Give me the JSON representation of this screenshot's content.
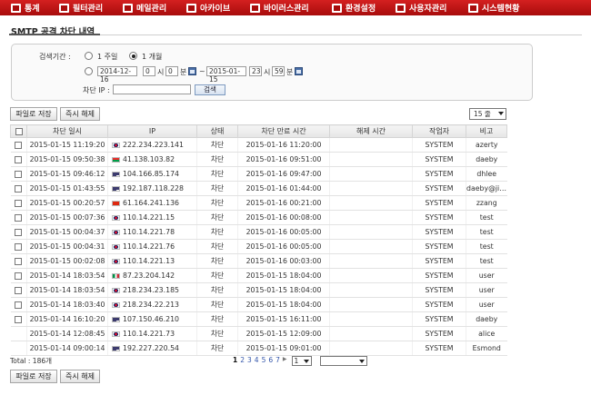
{
  "nav": [
    {
      "label": "통계",
      "icon": "chart-icon"
    },
    {
      "label": "필터관리",
      "icon": "filter-icon"
    },
    {
      "label": "메일관리",
      "icon": "mail-icon"
    },
    {
      "label": "아카이브",
      "icon": "archive-icon"
    },
    {
      "label": "바이러스관리",
      "icon": "virus-icon"
    },
    {
      "label": "환경설정",
      "icon": "settings-icon"
    },
    {
      "label": "사용자관리",
      "icon": "user-icon"
    },
    {
      "label": "시스템현황",
      "icon": "system-icon"
    }
  ],
  "page_title": "SMTP 공격 차단 내역",
  "search": {
    "period_label": "검색기간 :",
    "opt_week": "1 주일",
    "opt_month": "1 개월",
    "selected": "1 개월",
    "start_date": "2014-12-16",
    "start_hour": "0",
    "hour_unit": "시",
    "start_min": "0",
    "min_unit": "분",
    "tilde": "~",
    "end_date": "2015-01-15",
    "end_hour": "23",
    "end_min": "59",
    "ip_label": "차단 IP :",
    "ip_value": "",
    "search_button": "검색"
  },
  "toolbar": {
    "save_file": "파일로 저장",
    "unblock_now": "즉시 해제",
    "per_page": "15 줄"
  },
  "table": {
    "headers": [
      "차단 일시",
      "IP",
      "상태",
      "차단 만료 시간",
      "해제 시간",
      "작업자",
      "비고"
    ],
    "rows": [
      {
        "checkbox": true,
        "date": "2015-01-15 11:19:20",
        "flag": "kr",
        "ip": "222.234.223.141",
        "status": "차단",
        "expire": "2015-01-16 11:20:00",
        "release": "",
        "worker": "SYSTEM",
        "note": "azerty"
      },
      {
        "checkbox": true,
        "date": "2015-01-15 09:50:38",
        "flag": "bf",
        "ip": "41.138.103.82",
        "status": "차단",
        "expire": "2015-01-16 09:51:00",
        "release": "",
        "worker": "SYSTEM",
        "note": "daeby"
      },
      {
        "checkbox": true,
        "date": "2015-01-15 09:46:12",
        "flag": "us",
        "ip": "104.166.85.174",
        "status": "차단",
        "expire": "2015-01-16 09:47:00",
        "release": "",
        "worker": "SYSTEM",
        "note": "dhlee"
      },
      {
        "checkbox": true,
        "date": "2015-01-15 01:43:55",
        "flag": "us",
        "ip": "192.187.118.228",
        "status": "차단",
        "expire": "2015-01-16 01:44:00",
        "release": "",
        "worker": "SYSTEM",
        "note": "daeby@jiran..."
      },
      {
        "checkbox": true,
        "date": "2015-01-15 00:20:57",
        "flag": "cn",
        "ip": "61.164.241.136",
        "status": "차단",
        "expire": "2015-01-16 00:21:00",
        "release": "",
        "worker": "SYSTEM",
        "note": "zzang"
      },
      {
        "checkbox": true,
        "date": "2015-01-15 00:07:36",
        "flag": "kr",
        "ip": "110.14.221.15",
        "status": "차단",
        "expire": "2015-01-16 00:08:00",
        "release": "",
        "worker": "SYSTEM",
        "note": "test"
      },
      {
        "checkbox": true,
        "date": "2015-01-15 00:04:37",
        "flag": "kr",
        "ip": "110.14.221.78",
        "status": "차단",
        "expire": "2015-01-16 00:05:00",
        "release": "",
        "worker": "SYSTEM",
        "note": "test"
      },
      {
        "checkbox": true,
        "date": "2015-01-15 00:04:31",
        "flag": "kr",
        "ip": "110.14.221.76",
        "status": "차단",
        "expire": "2015-01-16 00:05:00",
        "release": "",
        "worker": "SYSTEM",
        "note": "test"
      },
      {
        "checkbox": true,
        "date": "2015-01-15 00:02:08",
        "flag": "kr",
        "ip": "110.14.221.13",
        "status": "차단",
        "expire": "2015-01-16 00:03:00",
        "release": "",
        "worker": "SYSTEM",
        "note": "test"
      },
      {
        "checkbox": true,
        "date": "2015-01-14 18:03:54",
        "flag": "it",
        "ip": "87.23.204.142",
        "status": "차단",
        "expire": "2015-01-15 18:04:00",
        "release": "",
        "worker": "SYSTEM",
        "note": "user"
      },
      {
        "checkbox": true,
        "date": "2015-01-14 18:03:54",
        "flag": "kr",
        "ip": "218.234.23.185",
        "status": "차단",
        "expire": "2015-01-15 18:04:00",
        "release": "",
        "worker": "SYSTEM",
        "note": "user"
      },
      {
        "checkbox": true,
        "date": "2015-01-14 18:03:40",
        "flag": "kr",
        "ip": "218.234.22.213",
        "status": "차단",
        "expire": "2015-01-15 18:04:00",
        "release": "",
        "worker": "SYSTEM",
        "note": "user"
      },
      {
        "checkbox": true,
        "date": "2015-01-14 16:10:20",
        "flag": "us",
        "ip": "107.150.46.210",
        "status": "차단",
        "expire": "2015-01-15 16:11:00",
        "release": "",
        "worker": "SYSTEM",
        "note": "daeby"
      },
      {
        "checkbox": false,
        "date": "2015-01-14 12:08:45",
        "flag": "kr",
        "ip": "110.14.221.73",
        "status": "차단",
        "expire": "2015-01-15 12:09:00",
        "release": "",
        "worker": "SYSTEM",
        "note": "alice"
      },
      {
        "checkbox": false,
        "date": "2015-01-14 09:00:14",
        "flag": "us",
        "ip": "192.227.220.54",
        "status": "차단",
        "expire": "2015-01-15 09:01:00",
        "release": "",
        "worker": "SYSTEM",
        "note": "Esmond"
      }
    ]
  },
  "total": "Total : 186개",
  "pager": {
    "pages": [
      "1",
      "2",
      "3",
      "4",
      "5",
      "6",
      "7"
    ],
    "current": "1",
    "next": "▶",
    "page_select": "1"
  },
  "colors": {
    "nav_red": "#b81212",
    "link_blue": "#3355aa"
  }
}
